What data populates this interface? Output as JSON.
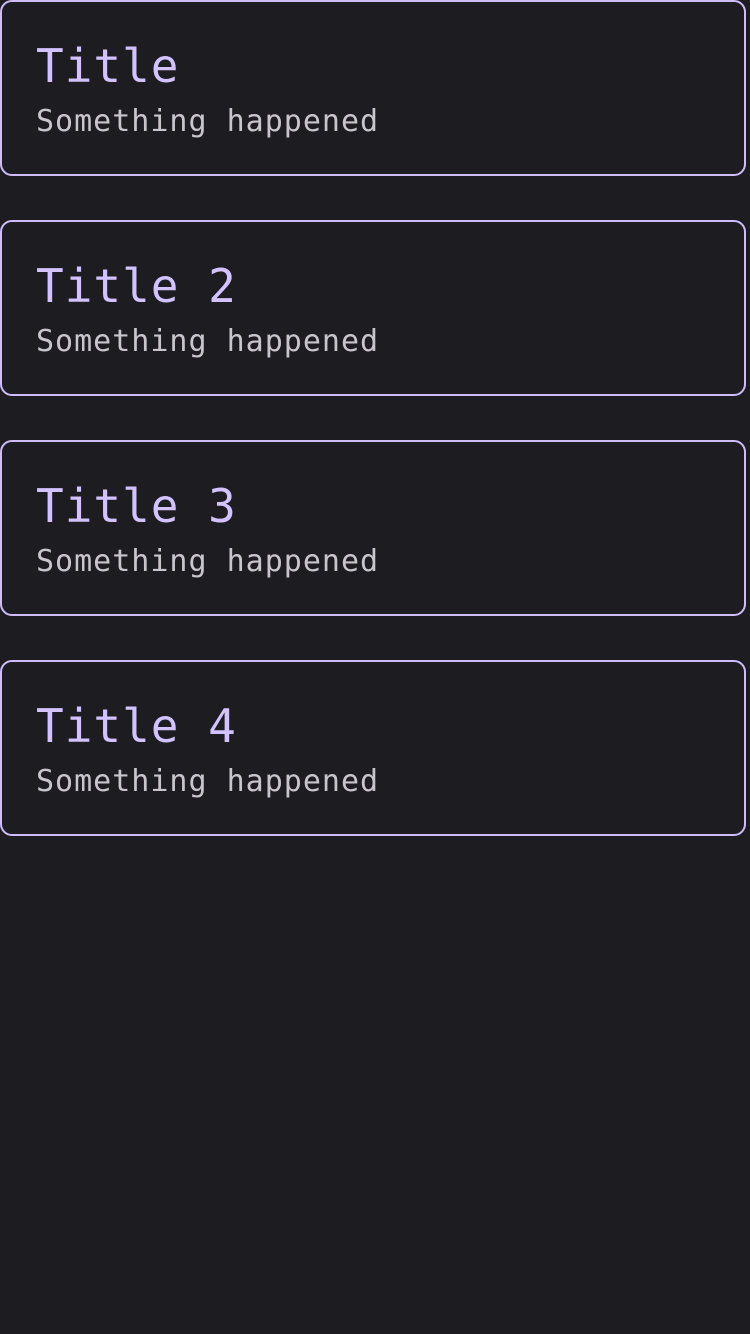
{
  "notifications": [
    {
      "title": "Title",
      "description": "Something happened"
    },
    {
      "title": "Title 2",
      "description": "Something happened"
    },
    {
      "title": "Title 3",
      "description": "Something happened"
    },
    {
      "title": "Title 4",
      "description": "Something happened"
    }
  ],
  "colors": {
    "background": "#1d1c21",
    "accent": "#cdbdfa",
    "title_text": "#d2c2ff",
    "body_text": "#c8c6cc"
  }
}
